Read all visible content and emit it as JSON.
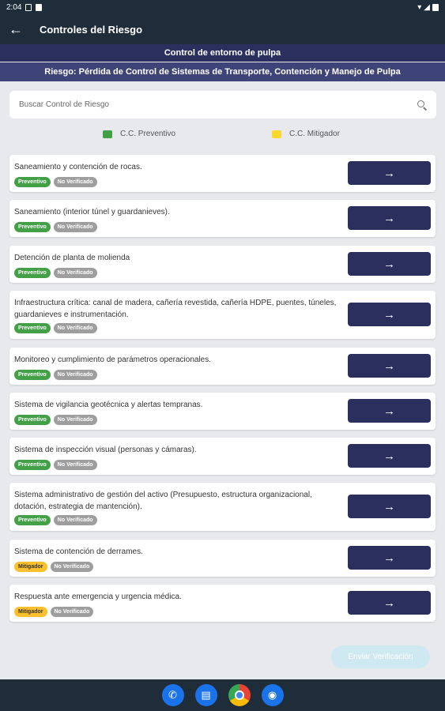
{
  "status": {
    "time": "2:04"
  },
  "app_bar": {
    "title": "Controles del Riesgo"
  },
  "banner": {
    "control": "Control de entorno de pulpa",
    "risk": "Riesgo: Pérdida de Control de Sistemas de Transporte, Contención y Manejo de Pulpa"
  },
  "search": {
    "placeholder": "Buscar Control de Riesgo"
  },
  "legend": {
    "preventive": {
      "label": "C.C. Preventivo",
      "color": "#43a047"
    },
    "mitigator": {
      "label": "C.C. Mitigador",
      "color": "#fbd82d"
    }
  },
  "controls": [
    {
      "title": "Saneamiento y contención de rocas.",
      "type": "Preventivo",
      "status": "No Verificado"
    },
    {
      "title": "Saneamiento (interior túnel y guardanieves).",
      "type": "Preventivo",
      "status": "No Verificado"
    },
    {
      "title": "Detención de planta de molienda",
      "type": "Preventivo",
      "status": "No Verificado"
    },
    {
      "title": "Infraestructura crítica: canal de madera, cañería revestida, cañería HDPE, puentes, túneles, guardanieves e instrumentación.",
      "type": "Preventivo",
      "status": "No Verificado"
    },
    {
      "title": "Monitoreo y cumplimiento de parámetros operacionales.",
      "type": "Preventivo",
      "status": "No Verificado"
    },
    {
      "title": "Sistema de vigilancia geotécnica y alertas tempranas.",
      "type": "Preventivo",
      "status": "No Verificado"
    },
    {
      "title": "Sistema de inspección visual (personas y cámaras).",
      "type": "Preventivo",
      "status": "No Verificado"
    },
    {
      "title": "Sistema administrativo de gestión del activo (Presupuesto, estructura organizacional, dotación, estrategia de mantención).",
      "type": "Preventivo",
      "status": "No Verificado"
    },
    {
      "title": "Sistema de contención de derrames.",
      "type": "Mitigador",
      "status": "No Verificado"
    },
    {
      "title": "Respuesta ante emergencia y urgencia médica.",
      "type": "Mitigador",
      "status": "No Verificado"
    }
  ],
  "arrow_label": "→",
  "submit_label": "Enviar Verificación"
}
